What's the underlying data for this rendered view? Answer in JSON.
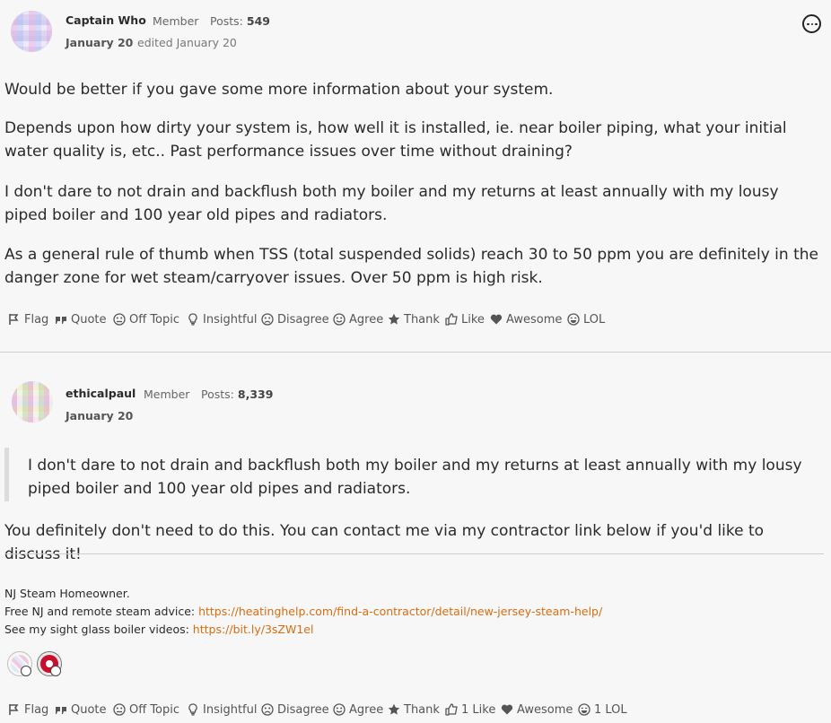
{
  "posts": [
    {
      "author": "Captain Who",
      "role": "Member",
      "posts_label": "Posts:",
      "posts_count": "549",
      "date": "January 20",
      "edited": "edited January 20",
      "paragraphs": [
        "Would be better if you gave some more information about your system.",
        "Depends upon how dirty your system is, how well it is installed, ie. near boiler piping, what your initial water quality is, etc.. Past performance issues over time without draining?",
        "I don't dare to not drain and backflush both my boiler and my returns at least annually with my lousy piped boiler and 100 year old pipes and radiators.",
        "As a general rule of thumb when TSS (total suspended solids) reach 30 to 50 ppm you are definitely in the danger zone for wet steam/carryover issues. Over 50 ppm is high risk."
      ],
      "reactions": {
        "flag": "Flag",
        "quote": "Quote",
        "off_topic": "Off Topic",
        "insightful": "Insightful",
        "disagree": "Disagree",
        "agree": "Agree",
        "thank": "Thank",
        "like": "Like",
        "awesome": "Awesome",
        "lol": "LOL"
      }
    },
    {
      "author": "ethicalpaul",
      "role": "Member",
      "posts_label": "Posts:",
      "posts_count": "8,339",
      "date": "January 20",
      "quote": "I don't dare to not drain and backflush both my boiler and my returns at least annually with my lousy piped boiler and 100 year old pipes and radiators.",
      "body": "You definitely don't need to do this. You can contact me via my contractor link below if you'd like to discuss it!",
      "signature": {
        "line1": "NJ Steam Homeowner.",
        "line2_prefix": "Free NJ and remote steam advice: ",
        "line2_link": "https://heatinghelp.com/find-a-contractor/detail/new-jersey-steam-help/",
        "line3_prefix": "See my sight glass boiler videos: ",
        "line3_link": "https://bit.ly/3sZW1el"
      },
      "reactions": {
        "flag": "Flag",
        "quote": "Quote",
        "off_topic": "Off Topic",
        "insightful": "Insightful",
        "disagree": "Disagree",
        "agree": "Agree",
        "thank": "Thank",
        "like": "1 Like",
        "awesome": "Awesome",
        "lol": "1 LOL"
      }
    }
  ],
  "icons": {
    "options": "options-icon",
    "flag": "flag-icon",
    "quote": "quote-icon",
    "off_topic": "off-topic-icon",
    "insightful": "lightbulb-icon",
    "disagree": "frown-icon",
    "agree": "smile-icon",
    "thank": "star-icon",
    "like": "thumbs-up-icon",
    "awesome": "heart-icon",
    "lol": "laugh-icon"
  },
  "colors": {
    "link": "#d76d10",
    "background": "#f7f7f7",
    "badge_red": "#c8102e"
  }
}
